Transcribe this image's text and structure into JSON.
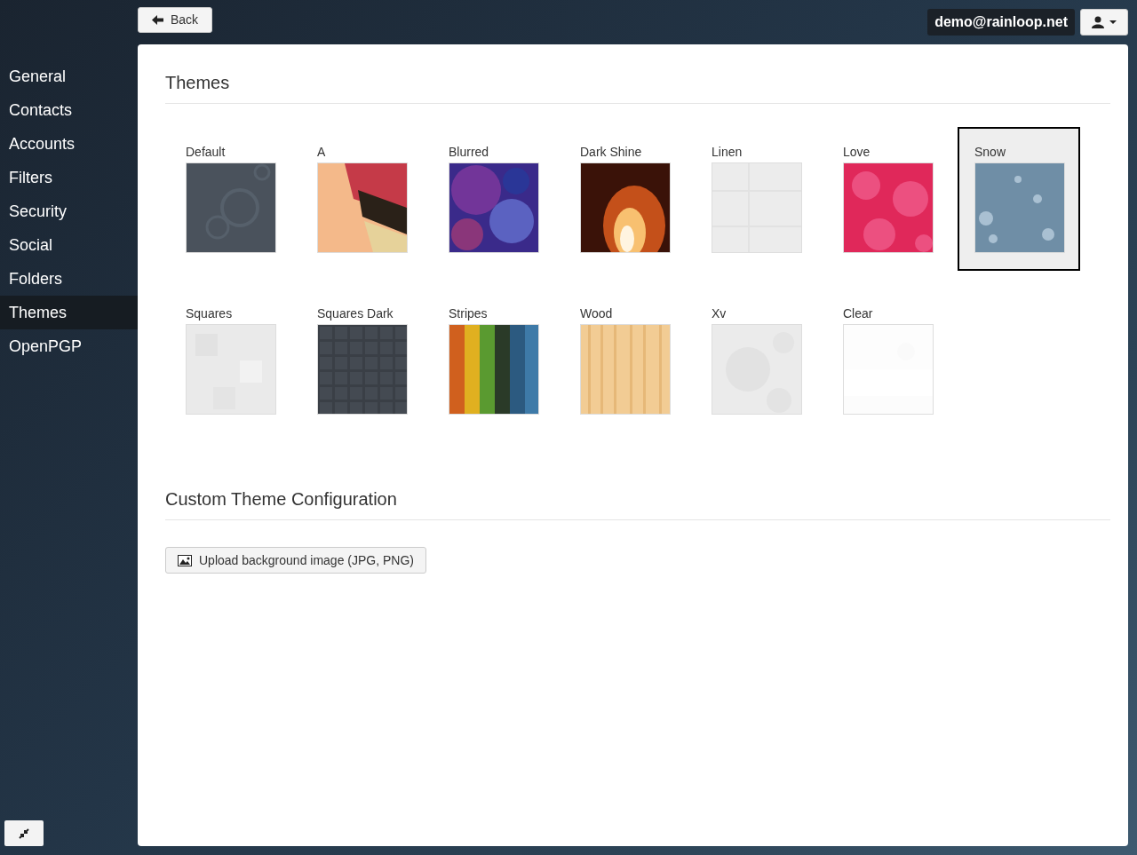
{
  "top_bar": {
    "back_button": "Back",
    "account_email": "demo@rainloop.net"
  },
  "sidebar": {
    "items": [
      {
        "label": "General",
        "selected": false
      },
      {
        "label": "Contacts",
        "selected": false
      },
      {
        "label": "Accounts",
        "selected": false
      },
      {
        "label": "Filters",
        "selected": false
      },
      {
        "label": "Security",
        "selected": false
      },
      {
        "label": "Social",
        "selected": false
      },
      {
        "label": "Folders",
        "selected": false
      },
      {
        "label": "Themes",
        "selected": true
      },
      {
        "label": "OpenPGP",
        "selected": false
      }
    ]
  },
  "themes": {
    "title": "Themes",
    "items": [
      {
        "name": "Default",
        "selected": false
      },
      {
        "name": "A",
        "selected": false
      },
      {
        "name": "Blurred",
        "selected": false
      },
      {
        "name": "Dark Shine",
        "selected": false
      },
      {
        "name": "Linen",
        "selected": false
      },
      {
        "name": "Love",
        "selected": false
      },
      {
        "name": "Snow",
        "selected": true
      },
      {
        "name": "Squares",
        "selected": false
      },
      {
        "name": "Squares Dark",
        "selected": false
      },
      {
        "name": "Stripes",
        "selected": false
      },
      {
        "name": "Wood",
        "selected": false
      },
      {
        "name": "Xv",
        "selected": false
      },
      {
        "name": "Clear",
        "selected": false
      }
    ]
  },
  "custom_theme": {
    "title": "Custom Theme Configuration",
    "upload_button": "Upload background image (JPG, PNG)"
  }
}
